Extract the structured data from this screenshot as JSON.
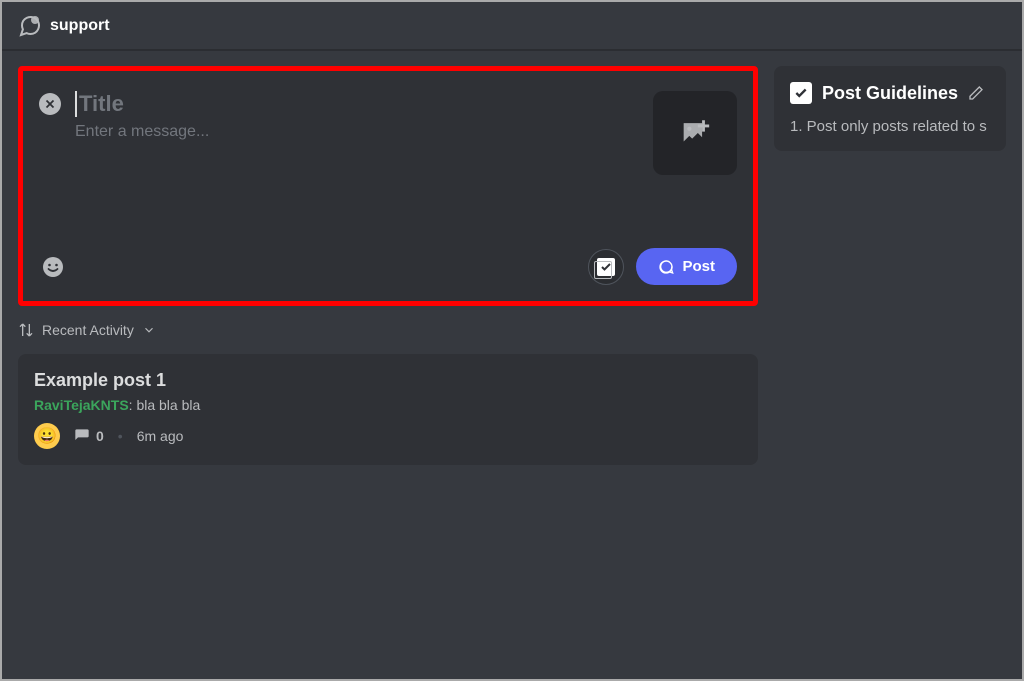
{
  "header": {
    "title": "support"
  },
  "compose": {
    "title_placeholder": "Title",
    "title_value": "",
    "message_placeholder": "Enter a message...",
    "message_value": "",
    "post_button_label": "Post"
  },
  "sort": {
    "label": "Recent Activity"
  },
  "posts": [
    {
      "title": "Example post 1",
      "author": "RaviTejaKNTS",
      "preview": "bla bla bla",
      "reaction_emoji": "😀",
      "comment_count": "0",
      "time_ago": "6m ago"
    }
  ],
  "guidelines": {
    "title": "Post Guidelines",
    "text": "1. Post only posts related to s"
  }
}
